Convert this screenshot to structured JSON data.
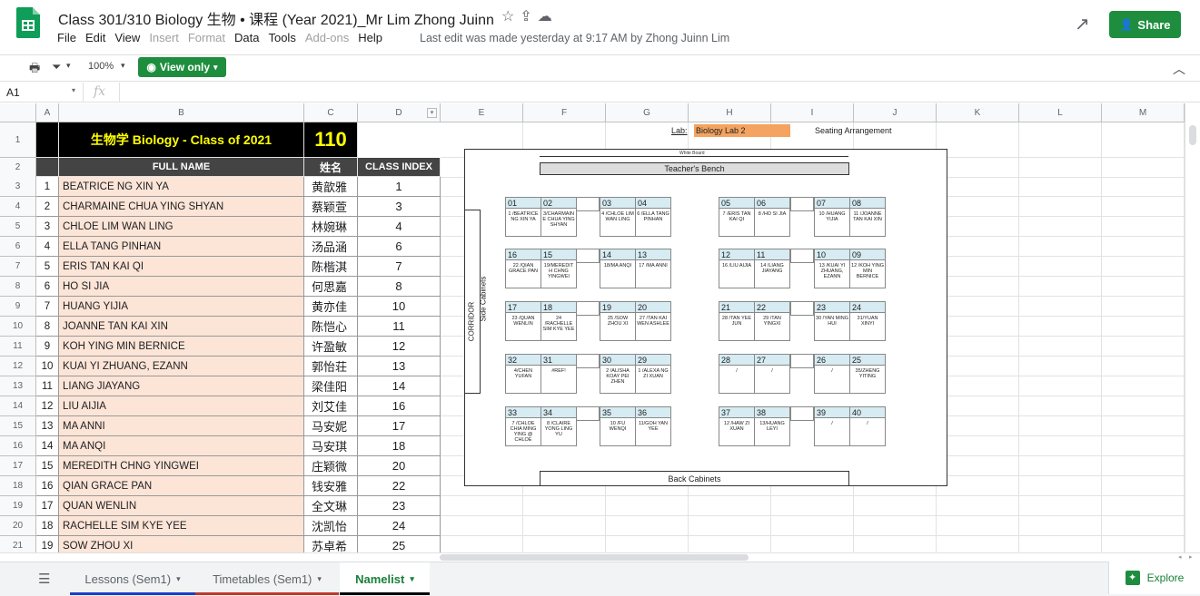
{
  "doc": {
    "title": "Class 301/310 Biology 生物 • 课程 (Year 2021)_Mr Lim Zhong Juinn",
    "menu": [
      "File",
      "Edit",
      "View",
      "Insert",
      "Format",
      "Data",
      "Tools",
      "Add-ons",
      "Help"
    ],
    "menu_disabled": [
      false,
      false,
      false,
      true,
      true,
      false,
      false,
      true,
      false
    ],
    "last_edit": "Last edit was made yesterday at 9:17 AM by Zhong Juinn Lim",
    "share_label": "Share"
  },
  "toolbar": {
    "zoom": "100%",
    "view_only": "View only"
  },
  "formula_bar": {
    "cell_ref": "A1",
    "fx": "fx"
  },
  "columns": [
    "A",
    "B",
    "C",
    "D",
    "E",
    "F",
    "G",
    "H",
    "I",
    "J",
    "K",
    "L",
    "M"
  ],
  "sheet": {
    "header_title": "生物学 Biology - Class of 2021",
    "header_count": "110",
    "col_full_name": "FULL NAME",
    "col_chinese": "姓名",
    "col_index": "CLASS INDEX",
    "lab_label": "Lab:",
    "lab_value": "Biology Lab 2",
    "seating_label": "Seating Arrangement",
    "rows": [
      {
        "r": "3",
        "no": "1",
        "name": "BEATRICE NG XIN YA",
        "cn": "黄歆雅",
        "idx": "1"
      },
      {
        "r": "4",
        "no": "2",
        "name": "CHARMAINE CHUA YING SHYAN",
        "cn": "蔡颖萱",
        "idx": "3"
      },
      {
        "r": "5",
        "no": "3",
        "name": "CHLOE LIM WAN LING",
        "cn": "林婉琳",
        "idx": "4"
      },
      {
        "r": "6",
        "no": "4",
        "name": "ELLA TANG PINHAN",
        "cn": "汤品涵",
        "idx": "6"
      },
      {
        "r": "7",
        "no": "5",
        "name": "ERIS TAN KAI QI",
        "cn": "陈楷淇",
        "idx": "7"
      },
      {
        "r": "8",
        "no": "6",
        "name": "HO SI JIA",
        "cn": "何思嘉",
        "idx": "8"
      },
      {
        "r": "9",
        "no": "7",
        "name": "HUANG YIJIA",
        "cn": "黄亦佳",
        "idx": "10"
      },
      {
        "r": "10",
        "no": "8",
        "name": "JOANNE TAN KAI XIN",
        "cn": "陈恺心",
        "idx": "11"
      },
      {
        "r": "11",
        "no": "9",
        "name": "KOH YING MIN BERNICE",
        "cn": "许盈敏",
        "idx": "12"
      },
      {
        "r": "12",
        "no": "10",
        "name": "KUAI YI ZHUANG, EZANN",
        "cn": "郭怡荘",
        "idx": "13"
      },
      {
        "r": "13",
        "no": "11",
        "name": "LIANG JIAYANG",
        "cn": "梁佳阳",
        "idx": "14"
      },
      {
        "r": "14",
        "no": "12",
        "name": "LIU AIJIA",
        "cn": "刘艾佳",
        "idx": "16"
      },
      {
        "r": "15",
        "no": "13",
        "name": "MA ANNI",
        "cn": "马安妮",
        "idx": "17"
      },
      {
        "r": "16",
        "no": "14",
        "name": "MA ANQI",
        "cn": "马安琪",
        "idx": "18"
      },
      {
        "r": "17",
        "no": "15",
        "name": "MEREDITH CHNG YINGWEI",
        "cn": "庄颖微",
        "idx": "20"
      },
      {
        "r": "18",
        "no": "16",
        "name": "QIAN GRACE PAN",
        "cn": "钱安雅",
        "idx": "22"
      },
      {
        "r": "19",
        "no": "17",
        "name": "QUAN WENLIN",
        "cn": "全文琳",
        "idx": "23"
      },
      {
        "r": "20",
        "no": "18",
        "name": "RACHELLE SIM KYE YEE",
        "cn": "沈凯怡",
        "idx": "24"
      },
      {
        "r": "21",
        "no": "19",
        "name": "SOW ZHOU XI",
        "cn": "苏卓希",
        "idx": "25"
      }
    ]
  },
  "seating": {
    "white_board": "White Board",
    "teachers_bench": "Teacher's Bench",
    "back_cabinets": "Back Cabinets",
    "corridor": "CORRIDOR",
    "side_cabinets": "Side Cabinets",
    "seats": [
      {
        "n": "01",
        "t": "1 /BEATRICE NG XIN YA"
      },
      {
        "n": "02",
        "t": "3/CHARMAIN E CHUA YING SHYAN"
      },
      {
        "n": "03",
        "t": "4 /CHLOE LIM WAN LING"
      },
      {
        "n": "04",
        "t": "6 /ELLA TANG PINHAN"
      },
      {
        "n": "05",
        "t": "7 /ERIS TAN KAI QI"
      },
      {
        "n": "06",
        "t": "8 /HO SI JIA"
      },
      {
        "n": "07",
        "t": "10 /HUANG YIJIA"
      },
      {
        "n": "08",
        "t": "11 /JOANNE TAN KAI XIN"
      },
      {
        "n": "16",
        "t": "22 /QIAN GRACE PAN"
      },
      {
        "n": "15",
        "t": "19/MEREDIT H CHNG YINGWEI"
      },
      {
        "n": "14",
        "t": "18/MA ANQI"
      },
      {
        "n": "13",
        "t": "17 /MA ANNI"
      },
      {
        "n": "12",
        "t": "16 /LIU AIJIA"
      },
      {
        "n": "11",
        "t": "14 /LIANG JIAYANG"
      },
      {
        "n": "10",
        "t": "13 /KUAI YI ZHUANG, EZANN"
      },
      {
        "n": "09",
        "t": "12 /KOH YING MIN BERNICE"
      },
      {
        "n": "17",
        "t": "23 /QUAN WENLIN"
      },
      {
        "n": "18",
        "t": "24 /RACHELLE SIM KYE YEE"
      },
      {
        "n": "19",
        "t": "25 /SOW ZHOU XI"
      },
      {
        "n": "20",
        "t": "27 /TAN KAI WEN ASHLEE"
      },
      {
        "n": "21",
        "t": "28 /TAN YEE JUN"
      },
      {
        "n": "22",
        "t": "29 /TAN YINGXI"
      },
      {
        "n": "23",
        "t": "30 /YAN MING HUI"
      },
      {
        "n": "24",
        "t": "31/YUAN XINYI"
      },
      {
        "n": "32",
        "t": "4/CHEN YUFAN"
      },
      {
        "n": "31",
        "t": "#REF!"
      },
      {
        "n": "30",
        "t": "2 /ALISHA KOAY PEI ZHEN"
      },
      {
        "n": "29",
        "t": "1 /ALEXA NG ZI XUAN"
      },
      {
        "n": "28",
        "t": "/"
      },
      {
        "n": "27",
        "t": "/"
      },
      {
        "n": "26",
        "t": "/"
      },
      {
        "n": "25",
        "t": "35/ZHENG YITING"
      },
      {
        "n": "33",
        "t": "7 /CHLOE CHIA MING YING @ CHLOE"
      },
      {
        "n": "34",
        "t": "8 /CLAIRE YONG LING YU"
      },
      {
        "n": "35",
        "t": "10 /FU WENQI"
      },
      {
        "n": "36",
        "t": "11/GOH YAN YEE"
      },
      {
        "n": "37",
        "t": "12 /HAW ZI XUAN"
      },
      {
        "n": "38",
        "t": "13/HUANG LEYI"
      },
      {
        "n": "39",
        "t": "/"
      },
      {
        "n": "40",
        "t": "/"
      }
    ]
  },
  "tabs": [
    {
      "label": "Lessons (Sem1)",
      "color": "#1a3fc7",
      "active": false
    },
    {
      "label": "Timetables (Sem1)",
      "color": "#c0392b",
      "active": false
    },
    {
      "label": "Namelist",
      "color": "#000000",
      "active": true
    }
  ],
  "explore_label": "Explore"
}
